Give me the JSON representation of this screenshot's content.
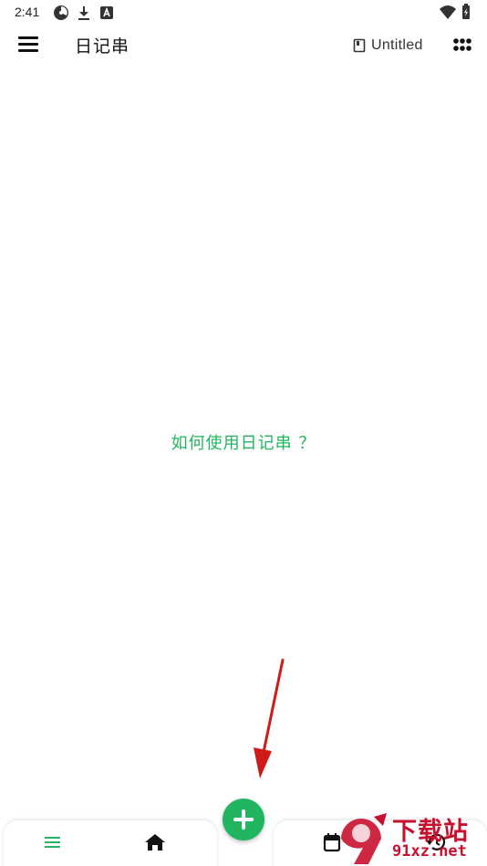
{
  "status_bar": {
    "time": "2:41",
    "icons": [
      "radiation-icon",
      "download-icon",
      "a-box-icon"
    ],
    "right_icons": [
      "wifi-icon",
      "battery-icon"
    ]
  },
  "app_bar": {
    "title": "日记串",
    "notebook_name": "Untitled",
    "notebook_icon": "book-icon",
    "grid_icon": "grid-icon",
    "menu_icon": "hamburger-icon"
  },
  "main": {
    "help_link": "如何使用日记串 ？"
  },
  "bottom_nav": {
    "items": [
      "list-icon",
      "home-icon",
      "calendar-icon",
      "history-icon"
    ],
    "fab_icon": "plus-icon"
  },
  "watermark": {
    "title": "下载站",
    "url": "91xz.net"
  },
  "colors": {
    "accent": "#22b55f",
    "annotation_arrow": "#d01a1a",
    "watermark": "#c8102e"
  }
}
